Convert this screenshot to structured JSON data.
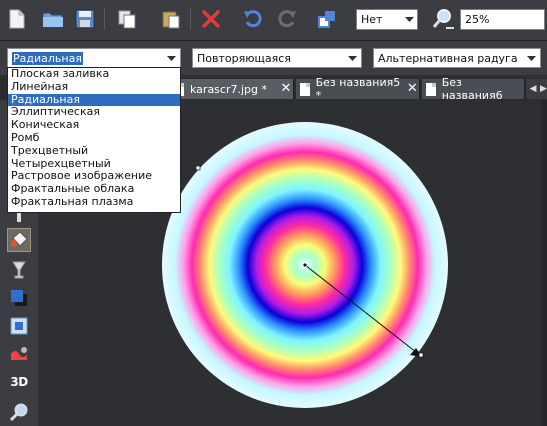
{
  "toolbar": {
    "buttons": [
      {
        "name": "new-document-icon"
      },
      {
        "name": "open-folder-icon"
      },
      {
        "name": "save-icon"
      },
      {
        "name": "copy-icon"
      },
      {
        "name": "paste-icon"
      },
      {
        "name": "delete-icon"
      },
      {
        "name": "undo-icon"
      },
      {
        "name": "redo-icon"
      },
      {
        "name": "transform-icon"
      },
      {
        "name": "zoom-icon"
      }
    ],
    "quality_select": "Нет",
    "zoom_value": "25%"
  },
  "fill_bar": {
    "fill_type": "Радиальная",
    "repeat_mode": "Повторяющаяся",
    "color_scheme": "Альтернативная радуга"
  },
  "fill_type_options": [
    "Плоская заливка",
    "Линейная",
    "Радиальная",
    "Эллиптическая",
    "Коническая",
    "Ромб",
    "Трехцветный",
    "Четырехцветный",
    "Растровое изображение",
    "Фрактальные облака",
    "Фрактальная плазма"
  ],
  "selected_option_index": 2,
  "tabs": [
    {
      "label": "karascr7.jpg *",
      "active": true
    },
    {
      "label": "Без названия5 *",
      "active": false
    },
    {
      "label": "Без названия6",
      "active": false
    }
  ],
  "left_tools": [
    {
      "name": "text-tool-icon"
    },
    {
      "name": "fill-tool-icon",
      "active": true
    },
    {
      "name": "transparency-tool-icon"
    },
    {
      "name": "shadow-tool-icon"
    },
    {
      "name": "bevel-tool-icon"
    },
    {
      "name": "mould-tool-icon"
    },
    {
      "name": "3d-extrude-tool-icon"
    },
    {
      "name": "zoom-tool-icon"
    }
  ],
  "labels": {
    "tool_3d": "3D"
  },
  "colors": {
    "app_background": "#2d2f33",
    "toolbar_background": "#3b3d42",
    "selection_blue": "#2f6bbf"
  }
}
